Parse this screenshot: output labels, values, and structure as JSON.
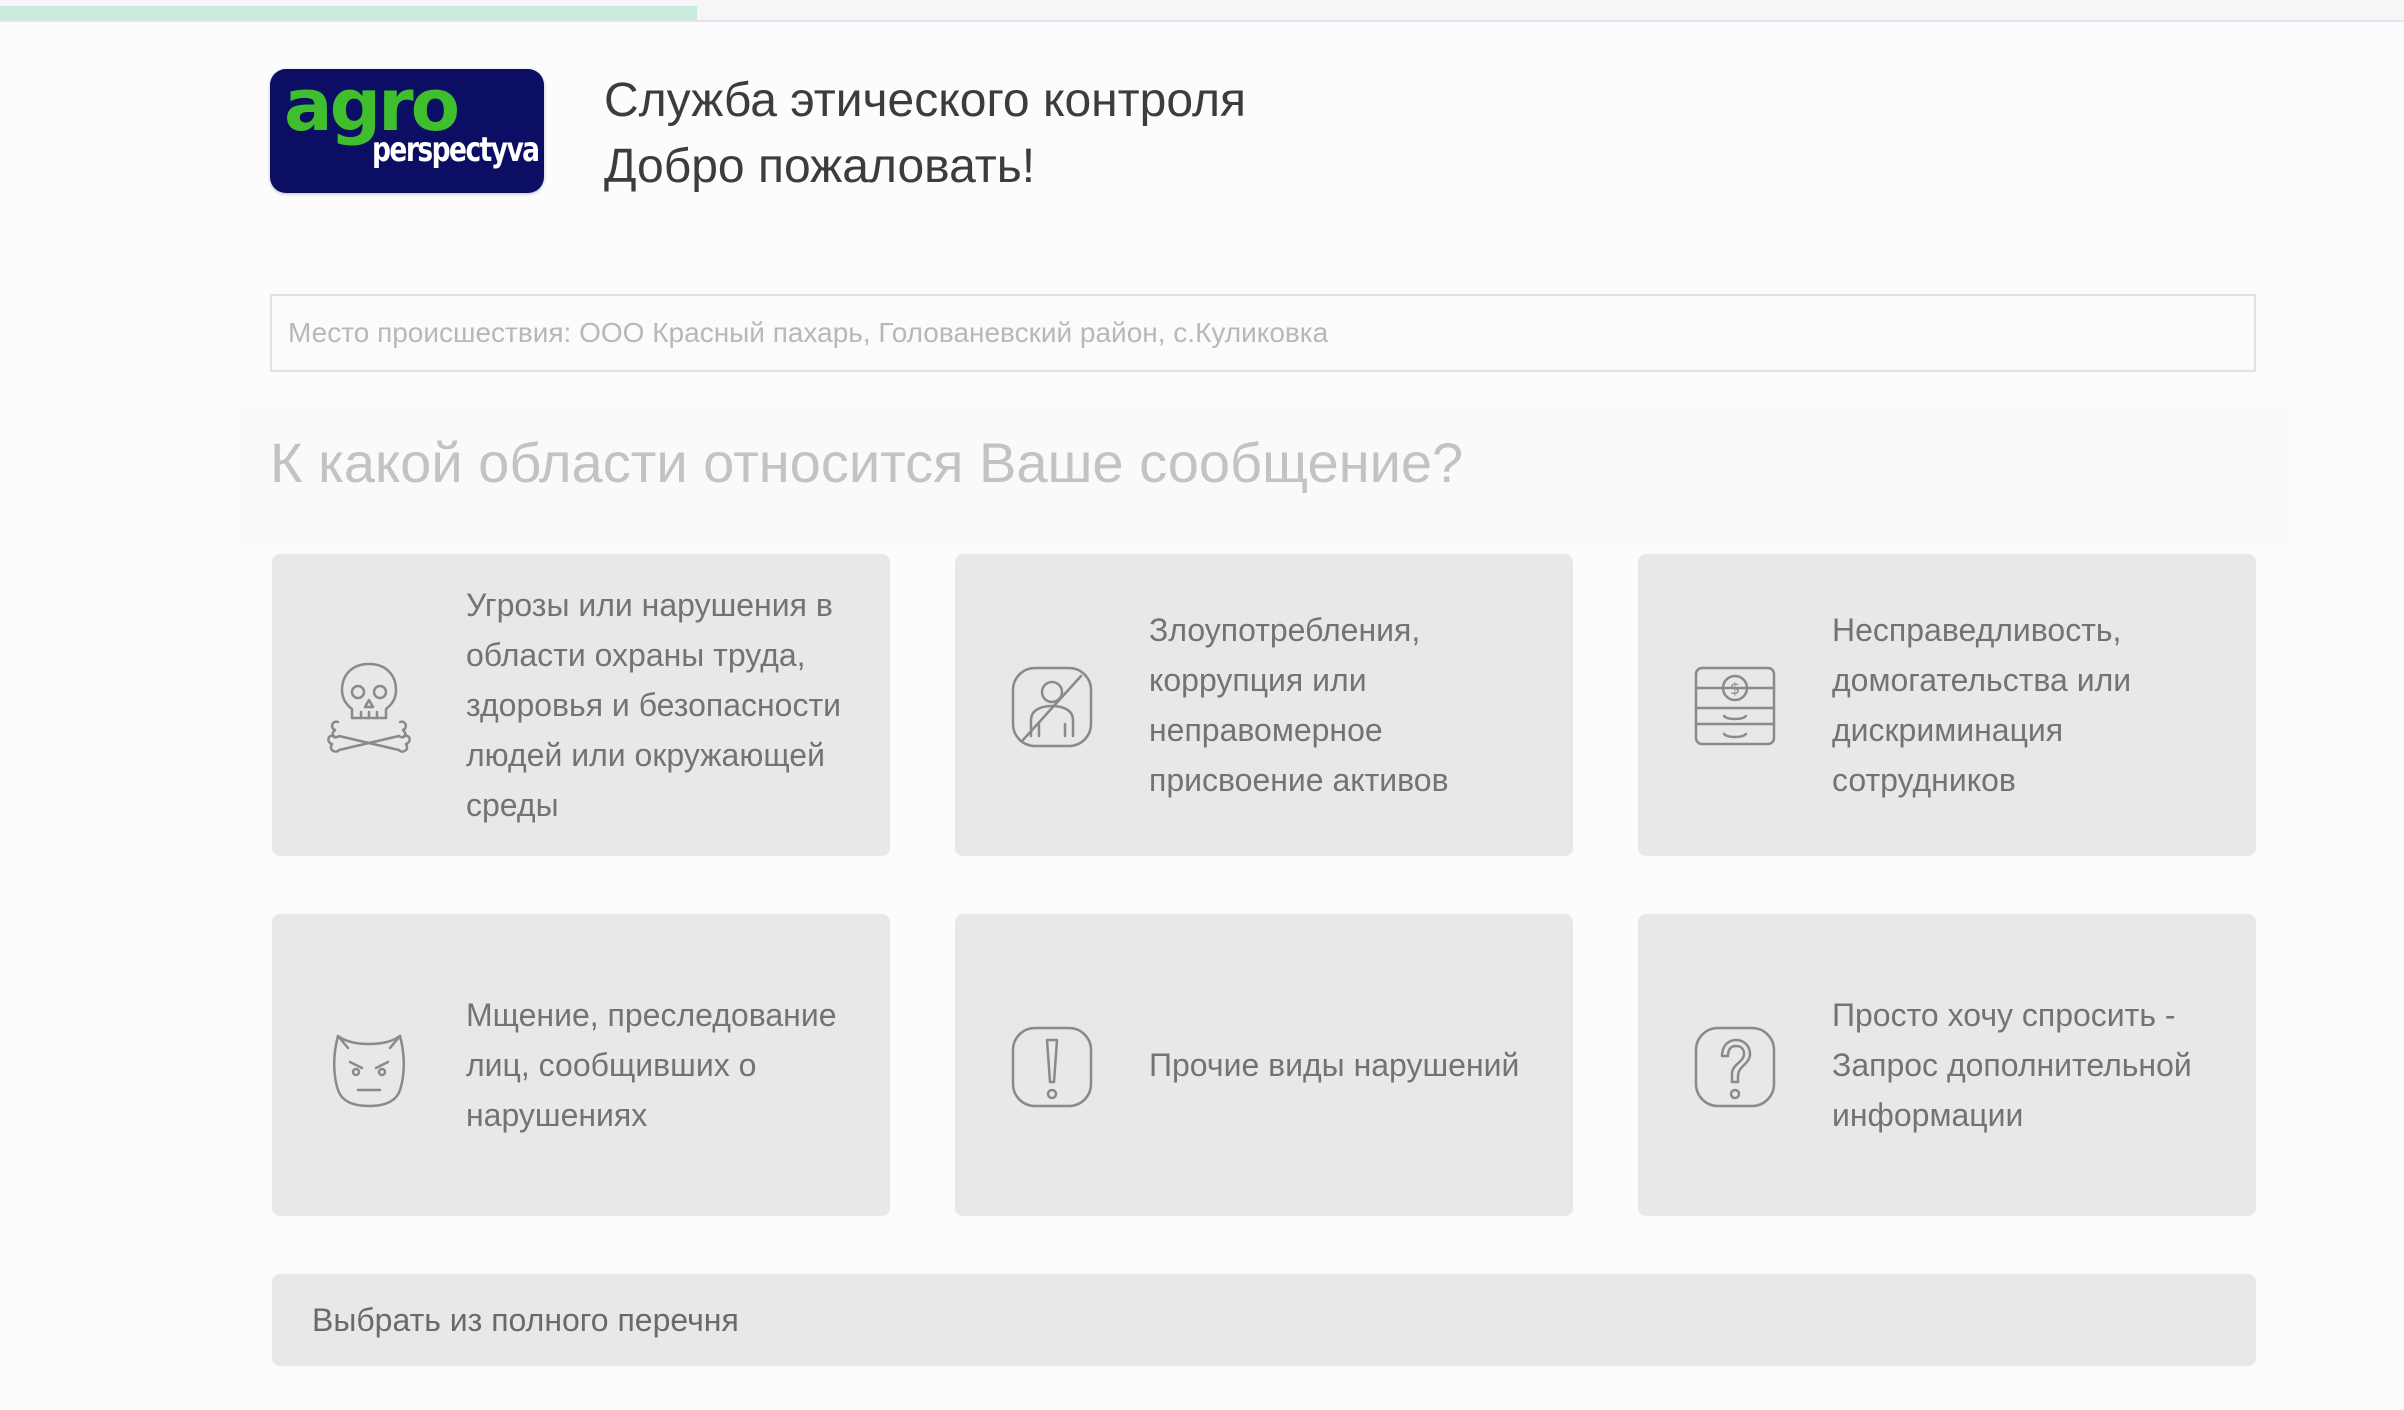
{
  "progress": {
    "percent": 29
  },
  "header": {
    "logo": {
      "word": "agro",
      "sub": "perspectyva",
      "bg_color": "#0b0e63",
      "word_color": "#3fbf2e"
    },
    "title": "Служба этического контроля",
    "greeting": "Добро пожаловать!"
  },
  "location": {
    "placeholder": "Место происшествия: ООО Красный пахарь, Голованевский район, с.Куликовка"
  },
  "question": "К какой области относится Ваше сообщение?",
  "categories": [
    {
      "icon": "skull-crossbones-icon",
      "label": "Угрозы или нарушения в области охраны труда, здоровья и безопасности людей или окружающей среды"
    },
    {
      "icon": "no-bribe-icon",
      "label": "Злоупотребления, коррупция или неправомерное присвоение активов"
    },
    {
      "icon": "money-stack-icon",
      "label": "Несправедливость, домогательства или дискриминация сотрудников"
    },
    {
      "icon": "devil-face-icon",
      "label": "Мщение, преследование лиц, сообщивших о нарушениях"
    },
    {
      "icon": "exclamation-icon",
      "label": "Прочие виды нарушений"
    },
    {
      "icon": "question-icon",
      "label": "Просто хочу спросить - Запрос дополнительной информации"
    }
  ],
  "full_list_label": "Выбрать из полного перечня",
  "colors": {
    "card_bg": "#e8e8e8",
    "icon_stroke": "#8a8a8a",
    "progress_fill": "#c9ebdb"
  }
}
